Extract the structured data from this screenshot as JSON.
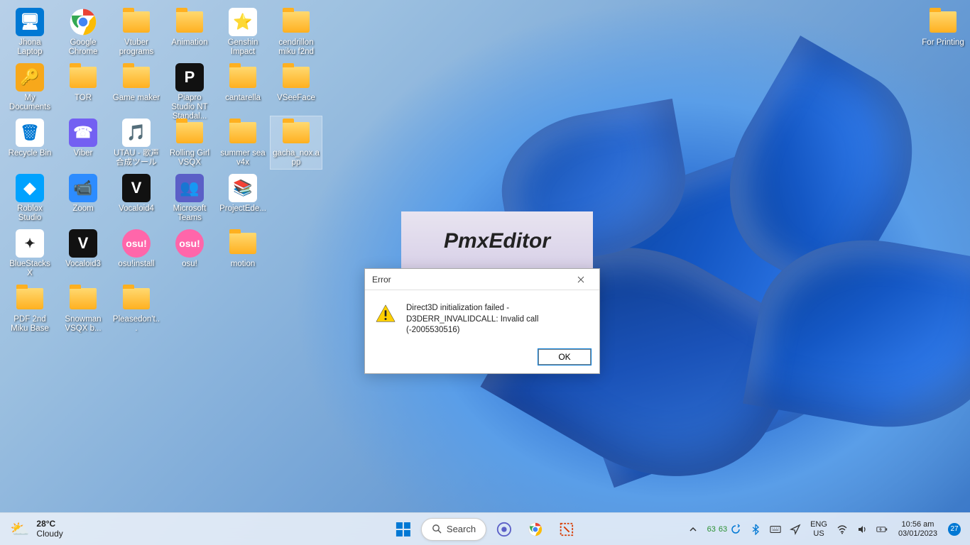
{
  "desktop": {
    "icons": [
      {
        "row": 0,
        "col": 0,
        "label": "Jhona Laptop",
        "type": "pc"
      },
      {
        "row": 0,
        "col": 1,
        "label": "Google Chrome",
        "type": "chrome"
      },
      {
        "row": 0,
        "col": 2,
        "label": "Vtuber programs",
        "type": "folder"
      },
      {
        "row": 0,
        "col": 3,
        "label": "Animation",
        "type": "folder"
      },
      {
        "row": 0,
        "col": 4,
        "label": "Genshin Impact",
        "type": "genshin"
      },
      {
        "row": 0,
        "col": 5,
        "label": "cendrillon miku f2nd",
        "type": "folder"
      },
      {
        "row": 1,
        "col": 0,
        "label": "My Documents",
        "type": "docs"
      },
      {
        "row": 1,
        "col": 1,
        "label": "TOR",
        "type": "folder"
      },
      {
        "row": 1,
        "col": 2,
        "label": "Game maker",
        "type": "folder"
      },
      {
        "row": 1,
        "col": 3,
        "label": "Piapro Studio NT Standal...",
        "type": "piapro"
      },
      {
        "row": 1,
        "col": 4,
        "label": "cantarella",
        "type": "folder"
      },
      {
        "row": 1,
        "col": 5,
        "label": "VSeeFace",
        "type": "folder"
      },
      {
        "row": 2,
        "col": 0,
        "label": "Recycle Bin",
        "type": "recycle"
      },
      {
        "row": 2,
        "col": 1,
        "label": "Viber",
        "type": "viber"
      },
      {
        "row": 2,
        "col": 2,
        "label": "UTAU - 歌声合成ツール",
        "type": "utau"
      },
      {
        "row": 2,
        "col": 3,
        "label": "Rolling Girl VSQX",
        "type": "folder"
      },
      {
        "row": 2,
        "col": 4,
        "label": "summer sea v4x",
        "type": "folder"
      },
      {
        "row": 2,
        "col": 5,
        "label": "gacha_nox.app",
        "type": "folder-sel"
      },
      {
        "row": 3,
        "col": 0,
        "label": "Roblox Studio",
        "type": "roblox"
      },
      {
        "row": 3,
        "col": 1,
        "label": "Zoom",
        "type": "zoom"
      },
      {
        "row": 3,
        "col": 2,
        "label": "Vocaloid4",
        "type": "v4"
      },
      {
        "row": 3,
        "col": 3,
        "label": "Microsoft Teams",
        "type": "teams"
      },
      {
        "row": 3,
        "col": 4,
        "label": "ProjectEde...",
        "type": "winrar"
      },
      {
        "row": 4,
        "col": 0,
        "label": "BlueStacks X",
        "type": "bluestacks"
      },
      {
        "row": 4,
        "col": 1,
        "label": "Vocaloid3",
        "type": "v3"
      },
      {
        "row": 4,
        "col": 2,
        "label": "osu!install",
        "type": "osu"
      },
      {
        "row": 4,
        "col": 3,
        "label": "osu!",
        "type": "osu"
      },
      {
        "row": 4,
        "col": 4,
        "label": "motion",
        "type": "folder"
      },
      {
        "row": 5,
        "col": 0,
        "label": "PDF 2nd Miku Base",
        "type": "folder"
      },
      {
        "row": 5,
        "col": 1,
        "label": "Snowman VSQX b...",
        "type": "folder"
      },
      {
        "row": 5,
        "col": 2,
        "label": "Pleasedon't...",
        "type": "folder"
      },
      {
        "row": 0,
        "col": 17,
        "label": "For Printing",
        "type": "folder",
        "right": true
      }
    ]
  },
  "splash": {
    "title": "PmxEditor"
  },
  "dialog": {
    "title": "Error",
    "message_line1": "Direct3D initialization failed -",
    "message_line2": "D3DERR_INVALIDCALL: Invalid call (-2005530516)",
    "ok": "OK"
  },
  "taskbar": {
    "weather": {
      "temp": "28°C",
      "desc": "Cloudy"
    },
    "search": "Search",
    "stats": {
      "a": "63",
      "b": "63"
    },
    "lang": {
      "top": "ENG",
      "bottom": "US"
    },
    "clock": {
      "time": "10:56 am",
      "date": "03/01/2023"
    },
    "notif_count": "27"
  }
}
